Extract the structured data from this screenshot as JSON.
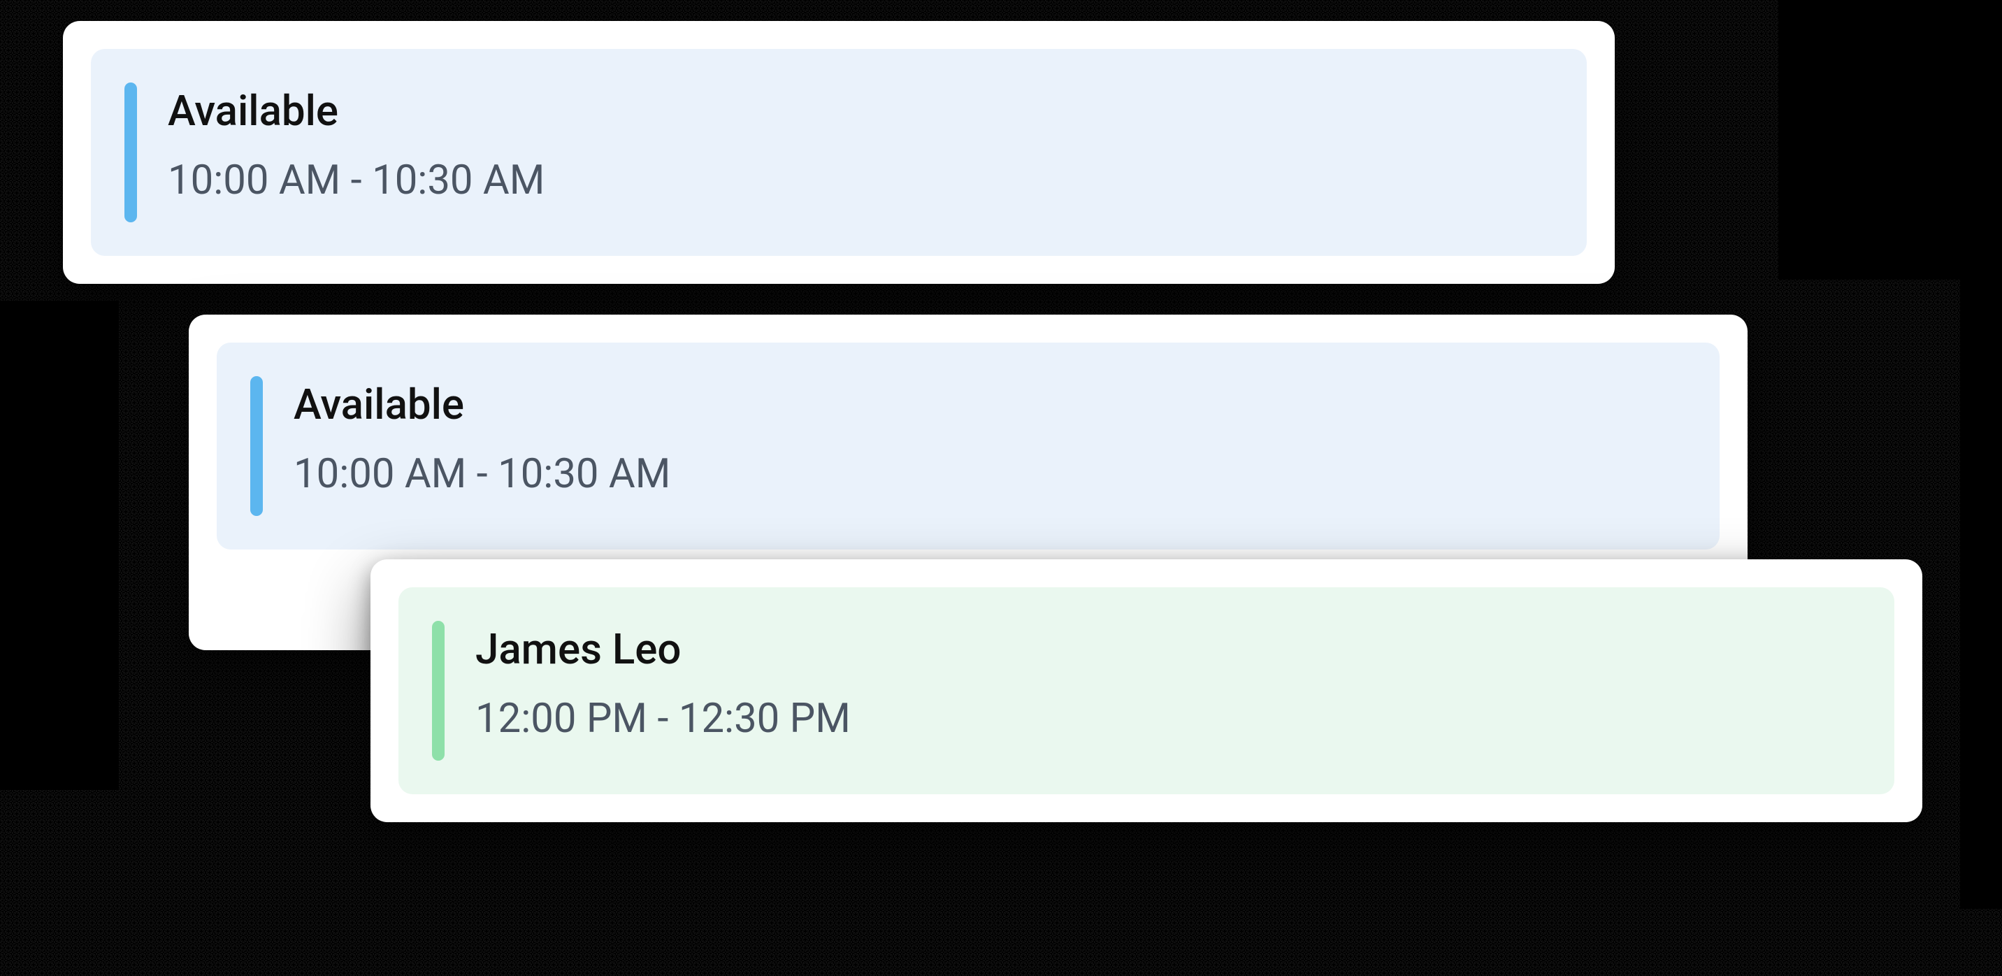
{
  "slots": [
    {
      "title": "Available",
      "time": "10:00 AM - 10:30 AM",
      "variant": "blue"
    },
    {
      "title": "Available",
      "time": "10:00 AM - 10:30 AM",
      "variant": "blue"
    },
    {
      "title": "James Leo",
      "time": "12:00 PM - 12:30 PM",
      "variant": "green"
    }
  ]
}
